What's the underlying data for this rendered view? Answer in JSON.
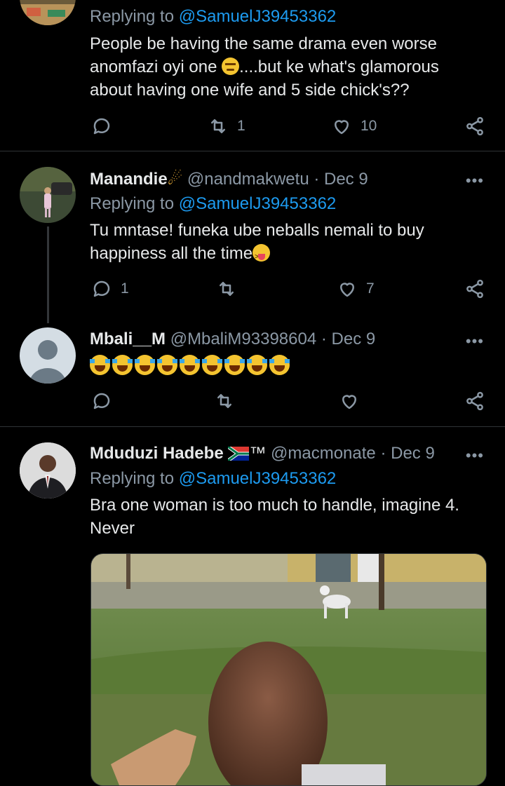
{
  "tweets": [
    {
      "replying_label": "Replying to",
      "replying_handle": "@SamuelJ39453362",
      "text_lines": [
        "People be having the same drama even worse",
        "anomfazi oyi one",
        "....but ke what's glamorous",
        "about having one wife and 5 side chick's??"
      ],
      "reply_count": "",
      "retweet_count": "1",
      "like_count": "10"
    },
    {
      "name": "Manandie",
      "handle": "@nandmakwetu",
      "date": "· Dec 9",
      "replying_label": "Replying to",
      "replying_handle": "@SamuelJ39453362",
      "text_lines": [
        "Tu mntase! funeka ube neballs nemali to buy",
        "happiness all the time"
      ],
      "reply_count": "1",
      "retweet_count": "",
      "like_count": "7"
    },
    {
      "name": "Mbali__M",
      "handle": "@MbaliM93398604",
      "date": "· Dec 9",
      "reply_count": "",
      "retweet_count": "",
      "like_count": ""
    },
    {
      "name": "Mduduzi Hadebe",
      "suffix": "™",
      "handle": "@macmonate",
      "date": "· Dec 9",
      "replying_label": "Replying to",
      "replying_handle": "@SamuelJ39453362",
      "text_lines": [
        "Bra one woman is too much to handle, imagine 4.",
        "Never"
      ]
    }
  ],
  "more_glyph": "•••",
  "icons": [
    "reply-icon",
    "retweet-icon",
    "like-icon",
    "share-icon",
    "more-icon"
  ]
}
